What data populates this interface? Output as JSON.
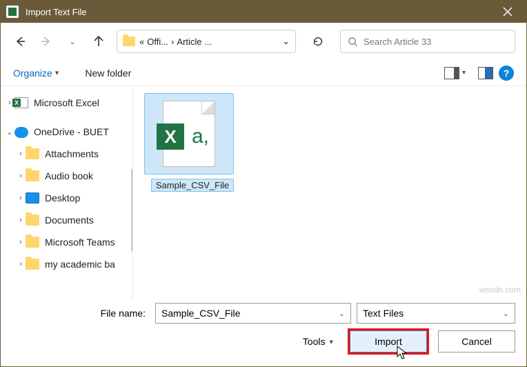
{
  "titlebar": {
    "title": "Import Text File"
  },
  "nav": {
    "crumb_prefix": "«",
    "crumb1": "Offi...",
    "crumb2": "Article ...",
    "search_placeholder": "Search Article 33"
  },
  "toolbar": {
    "organize": "Organize",
    "new_folder": "New folder"
  },
  "tree": {
    "excel": "Microsoft Excel",
    "onedrive": "OneDrive - BUET",
    "items": [
      "Attachments",
      "Audio book",
      "Desktop",
      "Documents",
      "Microsoft Teams",
      "my academic ba"
    ]
  },
  "file": {
    "name": "Sample_CSV_File"
  },
  "footer": {
    "filename_label": "File name:",
    "filename_value": "Sample_CSV_File",
    "filter": "Text Files",
    "tools": "Tools",
    "import": "Import",
    "cancel": "Cancel"
  },
  "watermark": "wsxdn.com"
}
